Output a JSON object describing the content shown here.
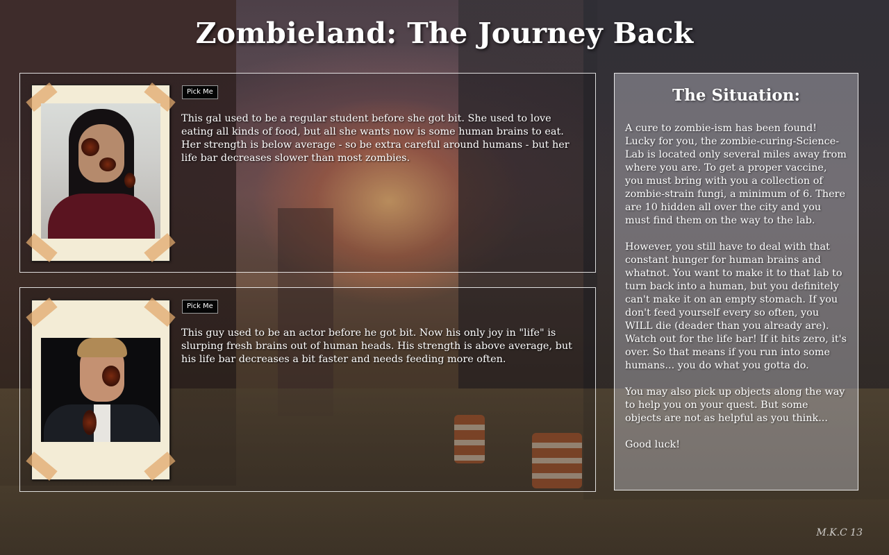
{
  "page": {
    "title": "Zombieland: The Journey Back"
  },
  "characters": [
    {
      "button_label": "Pick Me",
      "photo_icon": "zombie-girl-portrait",
      "description": "This gal used to be a regular student before she got bit. She used to love eating all kinds of food, but all she wants now is some human brains to eat. Her strength is below average - so be extra careful around humans - but her life bar decreases slower than most zombies."
    },
    {
      "button_label": "Pick Me",
      "photo_icon": "zombie-guy-portrait",
      "description": "This guy used to be an actor before he got bit. Now his only joy in \"life\" is slurping fresh brains out of human heads. His strength is above average, but his life bar decreases a bit faster and needs feeding more often."
    }
  ],
  "situation": {
    "heading": "The Situation:",
    "paragraphs": [
      "A cure to zombie-ism has been found! Lucky for you, the zombie-curing-Science-Lab is located only several miles away from where you are. To get a proper vaccine, you must bring with you a collection of zombie-strain fungi, a minimum of 6. There are 10 hidden all over the city and you must find them on the way to the lab.",
      "However, you still have to deal with that constant hunger for human brains and whatnot. You want to make it to that lab to turn back into a human, but you definitely can't make it on an empty stomach. If you don't feed yourself every so often, you WILL die (deader than you already are). Watch out for the life bar! If it hits zero, it's over. So that means if you run into some humans... you do what you gotta do.",
      "You may also pick up objects along the way to help you on your quest. But some objects are not as helpful as you think...",
      "Good luck!"
    ]
  },
  "background": {
    "signature": "M.K.C 13",
    "theme_colors": {
      "sky": "#7a5d5c",
      "sun": "#ffc478",
      "ground": "#4f4030"
    }
  }
}
